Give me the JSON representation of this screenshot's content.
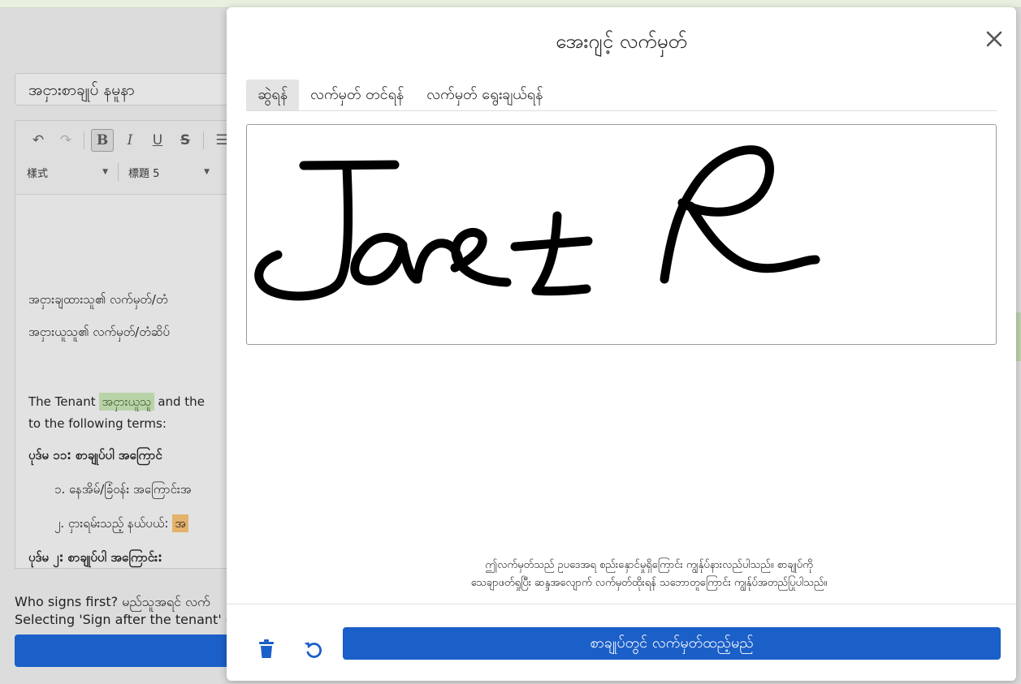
{
  "background": {
    "document_title_value": "အငှားစာချုပ် နမူနာ",
    "toolbar": {
      "style_select": "樣式",
      "heading_select": "標題 5"
    },
    "editor_lines": {
      "landlord_sig": "အငှားချထားသူ၏ လက်မှတ်/တံ",
      "tenant_sig": "အငှားယူသူ၏ လက်မှတ်/တံဆိပ်",
      "tenant_prefix": "The Tenant",
      "tenant_highlight": "အငှားယူသူ",
      "tenant_suffix": "and the",
      "following_terms": "to the following terms:",
      "article1": "ပုဒ်မ ၁၁: စာချုပ်ပါ အကြောင်",
      "item1": "၁. နေအိမ်/ခြံဝန်း အကြောင်းအ",
      "item2": "၂. ငှားရမ်းသည့် နယ်ပယ်:",
      "item2_highlight": "အ",
      "article2": "ပုဒ်မ ၂: စာချုပ်ပါ အကြောင်း:"
    },
    "signing_order_question": "Who signs first? မည်သူအရင် လက်",
    "signing_order_hint": "Selecting 'Sign after the tenant' ens"
  },
  "modal": {
    "title": "အေးဂျင့် လက်မှတ်",
    "tabs": [
      {
        "label": "ဆွဲရန်",
        "active": true
      },
      {
        "label": "လက်မှတ် တင်ရန်",
        "active": false
      },
      {
        "label": "လက်မှတ် ရွေးချယ်ရန်",
        "active": false
      }
    ],
    "legal_note_line1": "ဤလက်မှတ်သည် ဥပဒေအရ စည်းနှောင်မှုရှိကြောင်း ကျွန်ုပ်နားလည်ပါသည်။ စာချုပ်ကို",
    "legal_note_line2": "သေချာဖတ်ရှုပြီး ဆန္ဒအလျောက် လက်မှတ်ထိုးရန် သဘောတူကြောင်း ကျွန်ုပ်အတည်ပြုပါသည်။",
    "apply_button_label": "စာချုပ်တွင် လက်မှတ်ထည့်မည်",
    "accent_color": "#1b5fc8",
    "icons": [
      "close-icon",
      "trash-icon",
      "undo-icon"
    ]
  }
}
